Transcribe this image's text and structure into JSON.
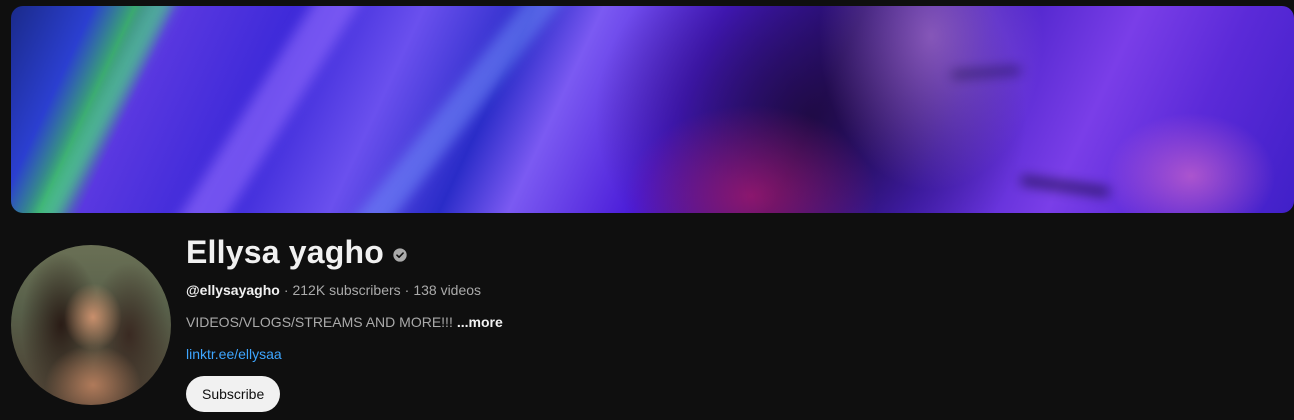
{
  "channel": {
    "name": "Ellysa yagho",
    "verified": true,
    "handle": "@ellysayagho",
    "subscribers": "212K subscribers",
    "videos": "138 videos",
    "separator": "·",
    "description": "VIDEOS/VLOGS/STREAMS AND MORE!!!",
    "more_label": "...more",
    "link": "linktr.ee/ellysaa",
    "subscribe_label": "Subscribe"
  },
  "icons": {
    "verified": "verified-check-icon"
  },
  "colors": {
    "background": "#0f0f0f",
    "text_primary": "#f1f1f1",
    "text_secondary": "#aaaaaa",
    "link": "#3ea6ff",
    "subscribe_bg": "#f1f1f1",
    "banner_accent": "#5b2ad8"
  }
}
